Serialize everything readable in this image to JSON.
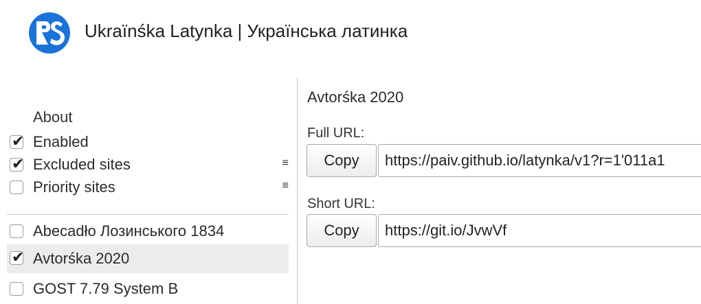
{
  "header": {
    "title": "Ukraïnśka Latynka | Українська латинка",
    "logo_icon": "rs-logo",
    "logo_color": "#1a73d9"
  },
  "sidebar": {
    "about_label": "About",
    "settings": [
      {
        "label": "Enabled",
        "checked": true
      },
      {
        "label": "Excluded sites",
        "checked": true,
        "menu_icon": "≡"
      },
      {
        "label": "Priority sites",
        "checked": false,
        "menu_icon": "≡"
      }
    ],
    "schemes": [
      {
        "label": "Abecadło Лозинського 1834",
        "checked": false,
        "selected": false
      },
      {
        "label": "Avtorśka 2020",
        "checked": true,
        "selected": true
      },
      {
        "label": "GOST 7.79 System B",
        "checked": false,
        "selected": false
      }
    ]
  },
  "main": {
    "title": "Avtorśka 2020",
    "full_url": {
      "label": "Full URL:",
      "copy_label": "Copy",
      "value": "https://paiv.github.io/latynka/v1?r=1'011a1"
    },
    "short_url": {
      "label": "Short URL:",
      "copy_label": "Copy",
      "value": "https://git.io/JvwVf"
    }
  }
}
